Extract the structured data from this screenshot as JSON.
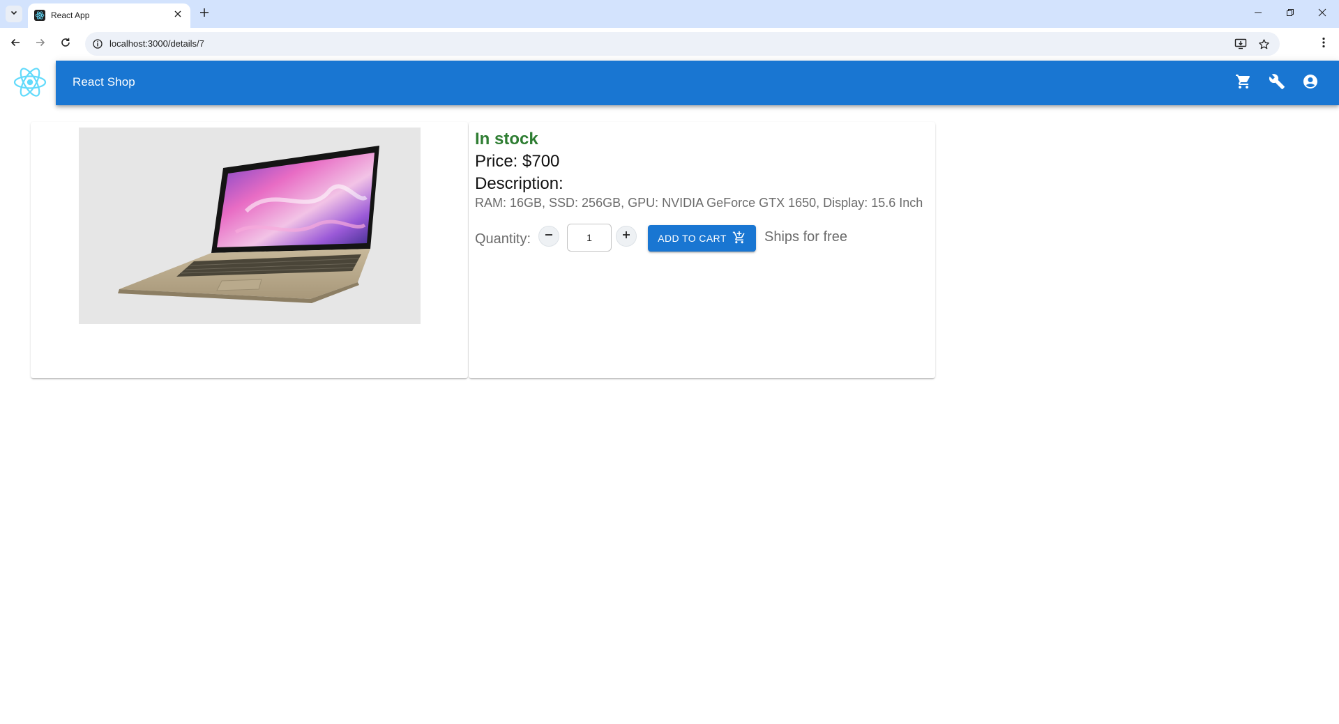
{
  "browser": {
    "tab_title": "React App",
    "url": "localhost:3000/details/7",
    "icons": {
      "tab_search": "chevron-down-icon",
      "close_tab": "close-icon",
      "new_tab": "plus-icon",
      "back": "arrow-left-icon",
      "forward": "arrow-right-icon",
      "reload": "reload-icon",
      "site_info": "info-icon",
      "install": "install-app-icon",
      "bookmark": "star-icon",
      "menu": "kebab-menu-icon"
    }
  },
  "app": {
    "title": "React Shop",
    "brand_color": "#1976d2",
    "icons": [
      "cart-icon",
      "wrench-icon",
      "account-icon"
    ]
  },
  "product": {
    "stock_status": "In stock",
    "stock_color": "#2e7d32",
    "price": "Price: $700",
    "description_label": "Description:",
    "description": "RAM: 16GB, SSD: 256GB, GPU: NVIDIA GeForce GTX 1650, Display: 15.6 Inch",
    "quantity_label": "Quantity:",
    "quantity_value": "1",
    "add_to_cart_label": "ADD TO CART",
    "shipping": "Ships for free"
  }
}
